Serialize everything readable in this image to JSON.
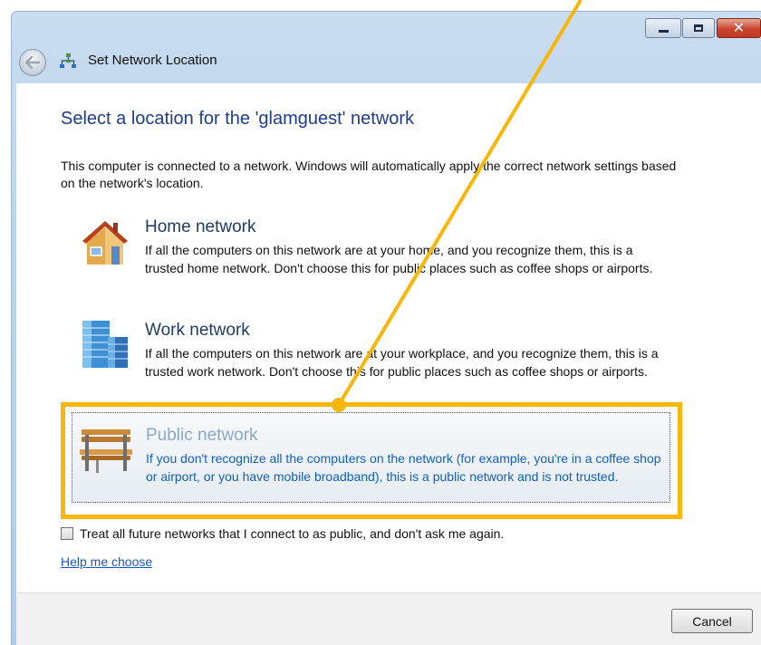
{
  "window": {
    "title": "Set Network Location"
  },
  "dialog": {
    "heading": "Select a location for the 'glamguest' network",
    "intro": "This computer is connected to a network. Windows will automatically apply the correct network settings based on the network's location."
  },
  "options": [
    {
      "title": "Home network",
      "description": "If all the computers on this network are at your home, and you recognize them, this is a trusted home network.  Don't choose this for public places such as coffee shops or airports.",
      "icon": "house-icon"
    },
    {
      "title": "Work network",
      "description": "If all the computers on this network are at your workplace, and you recognize them, this is a trusted work network.  Don't choose this for public places such as coffee shops or airports.",
      "icon": "office-building-icon"
    },
    {
      "title": "Public network",
      "description": "If you don't recognize all the computers on the network (for example, you're in a coffee shop or airport, or you have mobile broadband), this is a public network and is not trusted.",
      "icon": "park-bench-icon",
      "state": "hovered"
    }
  ],
  "checkbox": {
    "label": "Treat all future networks that I connect to as public, and don't ask me again.",
    "checked": false
  },
  "help_link": "Help me choose",
  "buttons": {
    "cancel": "Cancel"
  },
  "colors": {
    "highlight": "#f6b70a",
    "heading": "#1c3c8c",
    "link": "#1a56c8",
    "public_description": "#1060c0"
  }
}
